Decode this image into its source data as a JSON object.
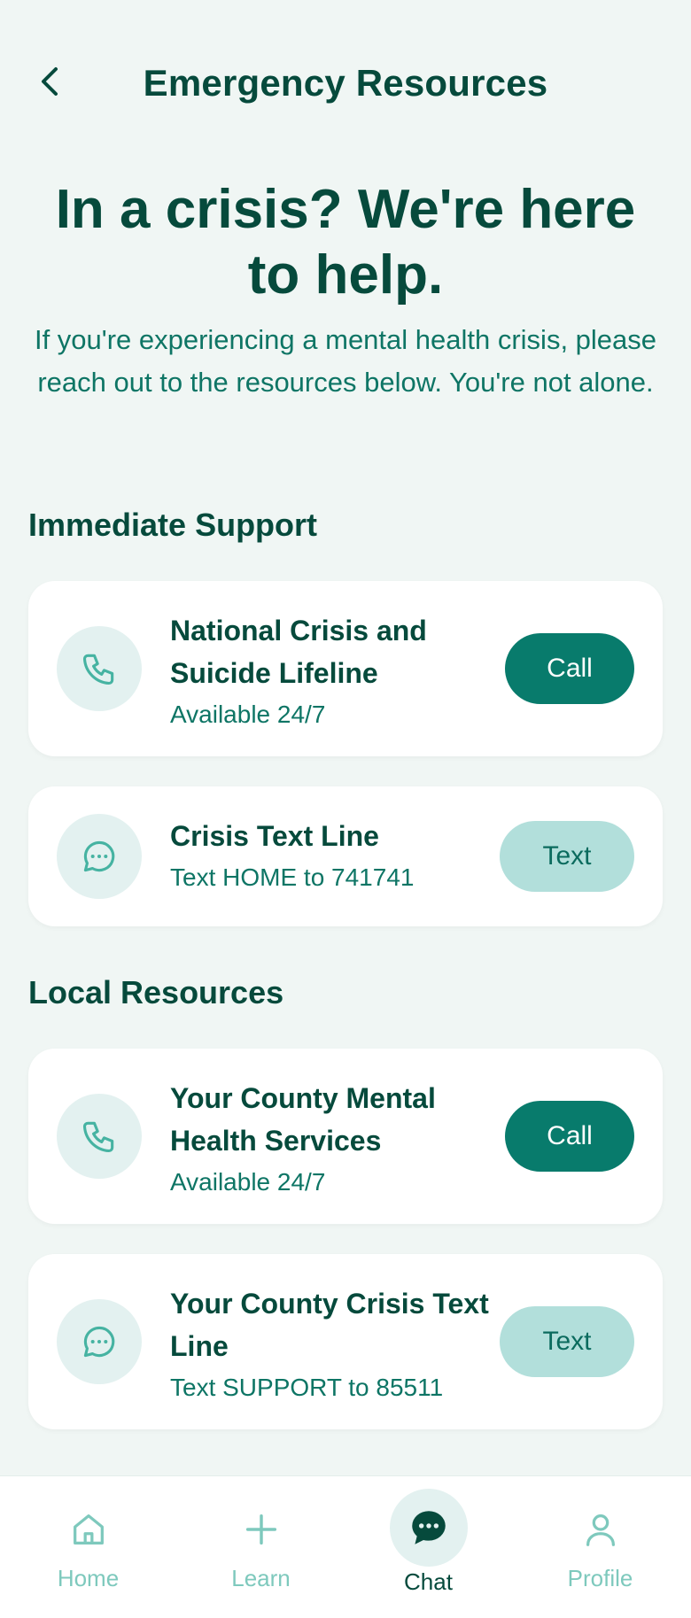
{
  "header": {
    "title": "Emergency Resources"
  },
  "hero": {
    "title": "In a crisis? We're here to help.",
    "subtitle": "If you're experiencing a mental health crisis, please reach out to the resources below. You're not alone."
  },
  "sections": [
    {
      "title": "Immediate Support",
      "cards": [
        {
          "icon": "phone-icon",
          "name": "National Crisis and Suicide Lifeline",
          "detail": "Available 24/7",
          "action_label": "Call"
        },
        {
          "icon": "chat-bubble-icon",
          "name": "Crisis Text Line",
          "detail": "Text HOME to 741741",
          "action_label": "Text"
        }
      ]
    },
    {
      "title": "Local Resources",
      "cards": [
        {
          "icon": "phone-icon",
          "name": "Your County Mental Health Services",
          "detail": "Available 24/7",
          "action_label": "Call"
        },
        {
          "icon": "chat-bubble-icon",
          "name": "Your County Crisis Text Line",
          "detail": "Text SUPPORT to 85511",
          "action_label": "Text"
        }
      ]
    }
  ],
  "nav": {
    "items": [
      {
        "label": "Home",
        "icon": "home-icon",
        "active": false
      },
      {
        "label": "Learn",
        "icon": "plus-icon",
        "active": false
      },
      {
        "label": "Chat",
        "icon": "chat-icon",
        "active": true
      },
      {
        "label": "Profile",
        "icon": "user-icon",
        "active": false
      }
    ]
  },
  "colors": {
    "background": "#f0f6f4",
    "primary_dark": "#064a3c",
    "accent": "#087b6c",
    "accent_light": "#b2dfdb",
    "icon_bg": "#e3f1f0",
    "nav_inactive": "#7ec9bd"
  }
}
